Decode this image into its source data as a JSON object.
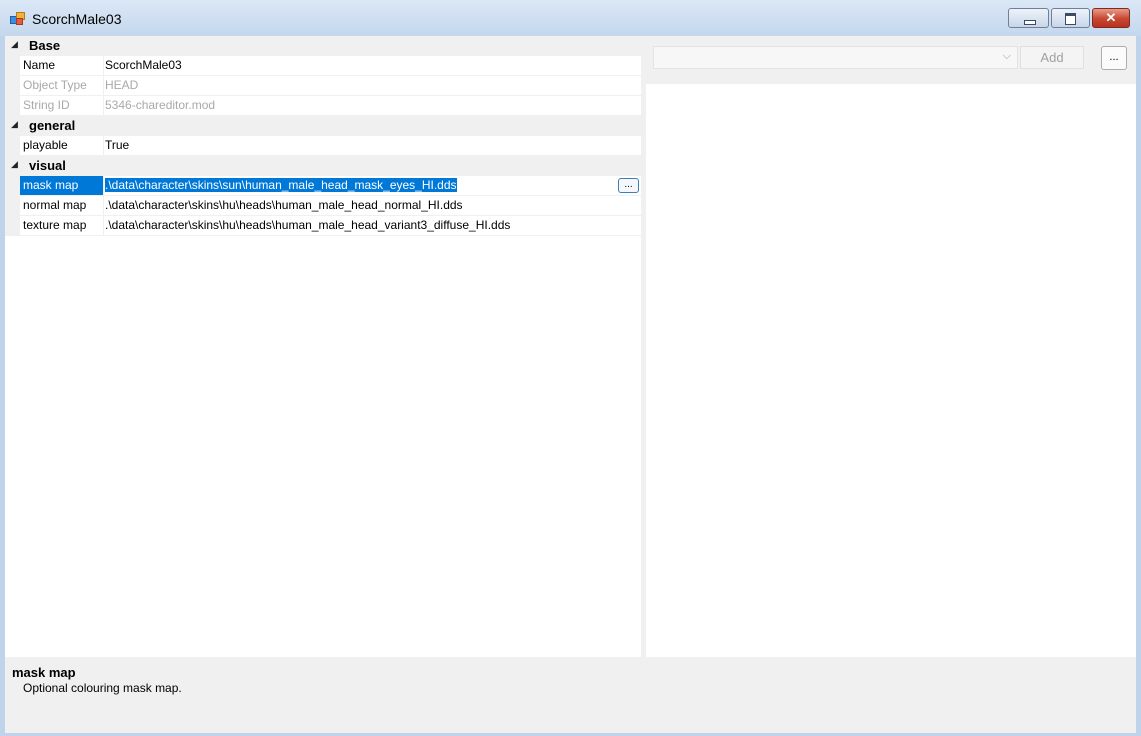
{
  "window": {
    "title": "ScorchMale03",
    "icon": "app-window-icon",
    "controls": {
      "minimize": "minimize-icon",
      "maximize": "maximize-icon",
      "close_label": "✕"
    }
  },
  "property_grid": {
    "categories": [
      {
        "label": "Base",
        "toggle": "◢",
        "props": [
          {
            "name": "Name",
            "value": "ScorchMale03",
            "disabled": false
          },
          {
            "name": "Object Type",
            "value": "HEAD",
            "disabled": true
          },
          {
            "name": "String ID",
            "value": "5346-chareditor.mod",
            "disabled": true
          }
        ]
      },
      {
        "label": "general",
        "toggle": "◢",
        "props": [
          {
            "name": "playable",
            "value": "True",
            "disabled": false
          }
        ]
      },
      {
        "label": "visual",
        "toggle": "◢",
        "props": [
          {
            "name": "mask map",
            "value": ".\\data\\character\\skins\\sun\\human_male_head_mask_eyes_HI.dds",
            "selected": true
          },
          {
            "name": "normal map",
            "value": ".\\data\\character\\skins\\hu\\heads\\human_male_head_normal_HI.dds"
          },
          {
            "name": "texture map",
            "value": ".\\data\\character\\skins\\hu\\heads\\human_male_head_variant3_diffuse_HI.dds"
          }
        ]
      }
    ],
    "ellipsis_label": "..."
  },
  "help": {
    "title": "mask map",
    "description": "Optional colouring mask map."
  },
  "right_panel": {
    "combo_value": "",
    "combo_arrow": "⌵",
    "add_label": "Add",
    "more_label": "..."
  },
  "colors": {
    "selection": "#0078d7",
    "disabled_text": "#a9a9a9",
    "close_button": "#c74631"
  }
}
